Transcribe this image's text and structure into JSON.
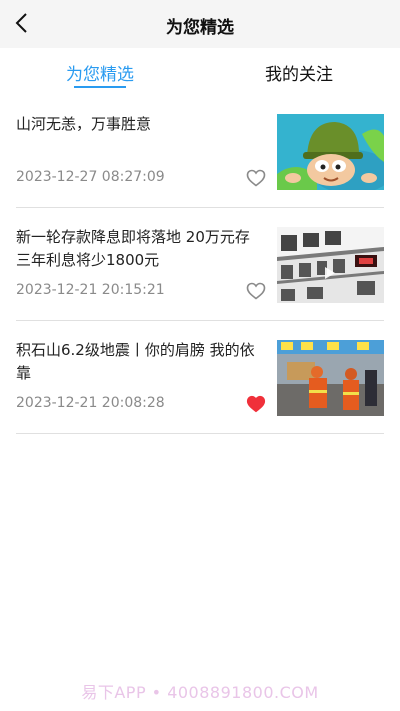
{
  "header": {
    "title": "为您精选"
  },
  "tabs": [
    {
      "label": "为您精选",
      "active": true
    },
    {
      "label": "我的关注",
      "active": false
    }
  ],
  "articles": [
    {
      "title": "山河无恙，万事胜意",
      "date": "2023-12-27 08:27:09",
      "liked": false,
      "thumbnail": "cartoon-soldier-image"
    },
    {
      "title": "新一轮存款降息即将落地 20万元存三年利息将少1800元",
      "date": "2023-12-21 20:15:21",
      "liked": false,
      "thumbnail": "bank-rate-board-image"
    },
    {
      "title": "积石山6.2级地震丨你的肩膀 我的依靠",
      "date": "2023-12-21 20:08:28",
      "liked": true,
      "thumbnail": "rescue-workers-image"
    }
  ],
  "watermark": "易下APP • 4008891800.COM",
  "colors": {
    "accent": "#2a9bf0",
    "liked": "#f0303a",
    "date_text": "#8a8a8a"
  }
}
